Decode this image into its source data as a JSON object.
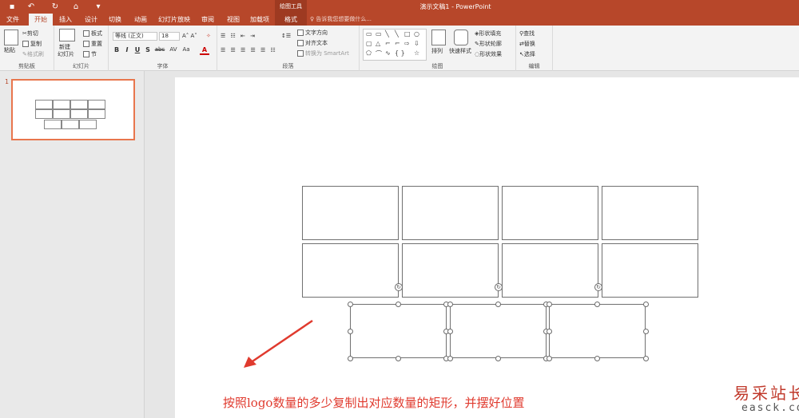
{
  "titlebar": {
    "quick_access": [
      "save-icon",
      "undo-icon",
      "redo-icon",
      "presenter-icon",
      "customize-icon"
    ],
    "contextual_title": "绘图工具",
    "document_title": "演示文稿1 - PowerPoint"
  },
  "tabs": [
    "文件",
    "开始",
    "插入",
    "设计",
    "切换",
    "动画",
    "幻灯片放映",
    "审阅",
    "视图",
    "加载项",
    "格式"
  ],
  "tell_me": "告诉我您想要做什么...",
  "ribbon": {
    "clipboard": {
      "paste": "粘贴",
      "cut": "剪切",
      "copy": "复制",
      "format_painter": "格式刷",
      "label": "剪贴板"
    },
    "slides": {
      "new_slide": "新建",
      "new_slide2": "幻灯片",
      "layout": "板式",
      "reset": "重置",
      "section": "节",
      "label": "幻灯片"
    },
    "font": {
      "font_name": "等线 (正文)",
      "font_size": "18",
      "bold": "B",
      "italic": "I",
      "underline": "U",
      "shadow": "S",
      "strike": "abc",
      "spacing": "AV",
      "case": "Aa",
      "color": "A",
      "label": "字体"
    },
    "paragraph": {
      "text_direction": "文字方向",
      "align_text": "对齐文本",
      "smartart": "转换为 SmartArt",
      "label": "段落"
    },
    "drawing": {
      "arrange": "排列",
      "quick_styles": "快速样式",
      "shape_fill": "形状填充",
      "shape_outline": "形状轮廓",
      "shape_effects": "形状效果",
      "label": "绘图"
    },
    "editing": {
      "find": "查找",
      "replace": "替换",
      "select": "选择",
      "label": "编辑"
    }
  },
  "thumbnail": {
    "slide_number": "1"
  },
  "slide": {
    "caption": "按照logo数量的多少复制出对应数量的矩形，并摆好位置",
    "watermark_cn": "易采站长站",
    "watermark_en": "easck.com",
    "accent_color": "#b7472a",
    "caption_color": "#e03a2e"
  }
}
